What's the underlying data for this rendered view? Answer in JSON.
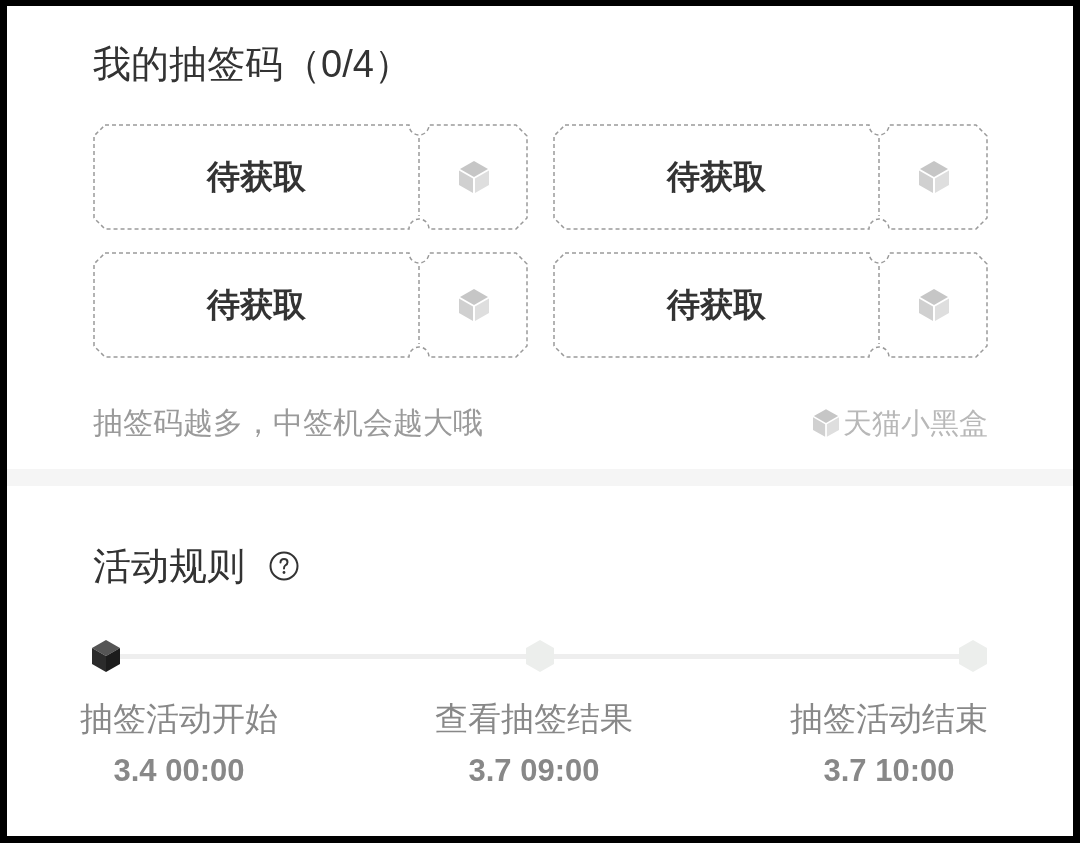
{
  "codes": {
    "title": "我的抽签码（0/4）",
    "tickets": [
      {
        "label": "待获取"
      },
      {
        "label": "待获取"
      },
      {
        "label": "待获取"
      },
      {
        "label": "待获取"
      }
    ],
    "hint": "抽签码越多，中签机会越大哦",
    "brand": "天猫小黑盒"
  },
  "rules": {
    "title": "活动规则",
    "steps": [
      {
        "label": "抽签活动开始",
        "time": "3.4 00:00",
        "active": true
      },
      {
        "label": "查看抽签结果",
        "time": "3.7 09:00",
        "active": false
      },
      {
        "label": "抽签活动结束",
        "time": "3.7 10:00",
        "active": false
      }
    ]
  }
}
